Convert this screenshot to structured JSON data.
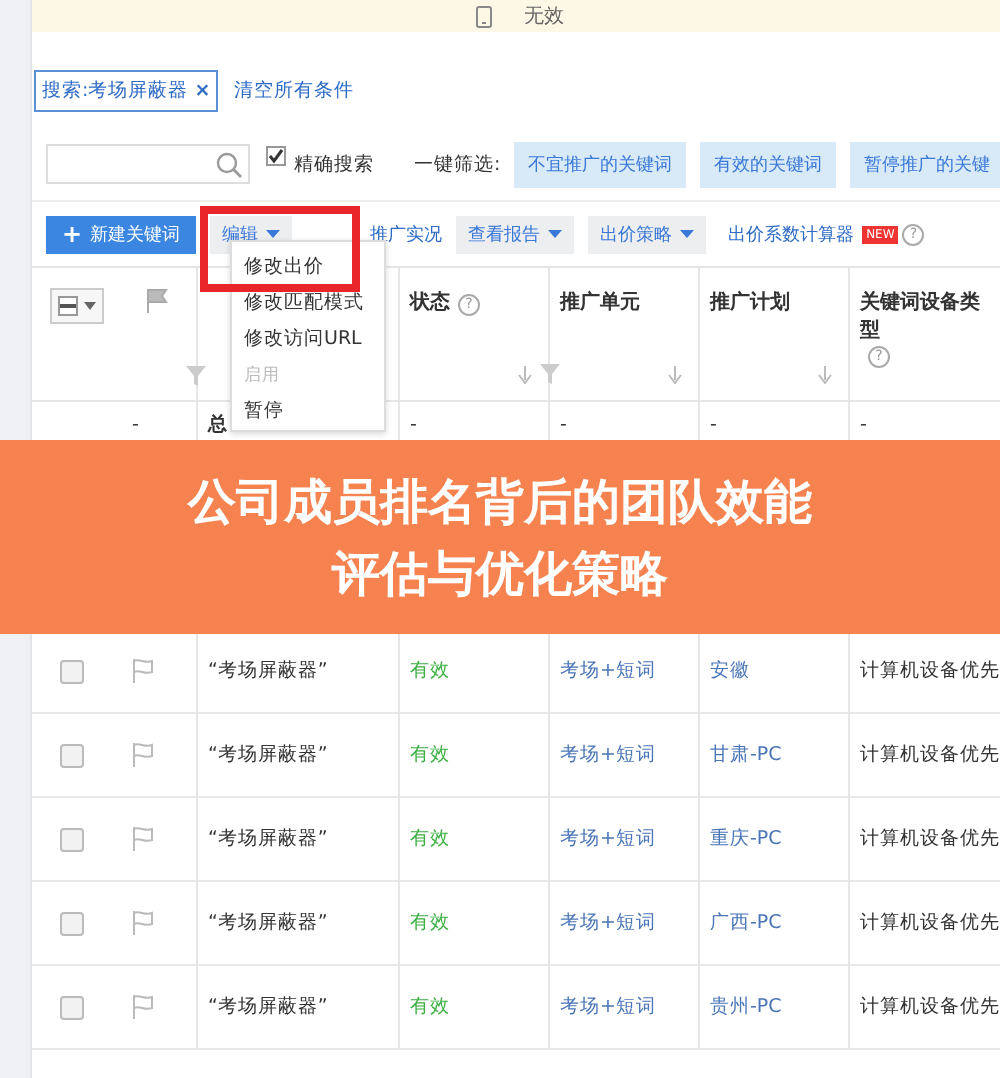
{
  "notice": {
    "text": "无效"
  },
  "filter_tags": [
    {
      "label": "搜索:考场屏蔽器",
      "remove": "×"
    }
  ],
  "clear_link": "清空所有条件",
  "search": {
    "exact_match": {
      "label": "精确搜索",
      "checked": true
    }
  },
  "quick_filter": {
    "label": "一键筛选:",
    "chips": [
      "不宜推广的关键词",
      "有效的关键词",
      "暂停推广的关键"
    ]
  },
  "toolbar": [
    {
      "kind": "primary",
      "label": "新建关键词",
      "icon": "+"
    },
    {
      "kind": "dropdown",
      "label": "编辑"
    },
    {
      "kind": "link",
      "label": "推广实况"
    },
    {
      "kind": "dropdown",
      "label": "查看报告"
    },
    {
      "kind": "dropdown",
      "label": "出价策略"
    },
    {
      "kind": "link",
      "label": "出价系数计算器",
      "badge": "NEW",
      "help": "?"
    }
  ],
  "edit_menu": {
    "items": [
      {
        "label": "修改出价",
        "disabled": false
      },
      {
        "label": "修改匹配模式",
        "disabled": false
      },
      {
        "label": "修改访问URL",
        "disabled": false
      },
      {
        "label": "启用",
        "disabled": true
      },
      {
        "label": "暂停",
        "disabled": false
      }
    ]
  },
  "table": {
    "select_all": {
      "indeterminate": true
    },
    "columns": [
      {
        "kind": "select"
      },
      {
        "kind": "flag"
      },
      {
        "kind": "keyword"
      },
      {
        "kind": "text",
        "label": "状态",
        "help": "?"
      },
      {
        "kind": "text",
        "label": "推广单元"
      },
      {
        "kind": "text",
        "label": "推广计划"
      },
      {
        "kind": "text",
        "label": "关键词设备类型",
        "help": "?"
      }
    ],
    "total_row": {
      "mark": "-",
      "label": "总",
      "cells": [
        "-",
        "-",
        "-",
        "-"
      ]
    },
    "rows": [
      {
        "selected": false,
        "keyword": "“考场屏蔽器”",
        "status": "有效",
        "unit": "考场+短词",
        "plan": "安徽",
        "device": "计算机设备优先"
      },
      {
        "selected": false,
        "keyword": "“考场屏蔽器”",
        "status": "有效",
        "unit": "考场+短词",
        "plan": "甘肃-PC",
        "device": "计算机设备优先"
      },
      {
        "selected": false,
        "keyword": "“考场屏蔽器”",
        "status": "有效",
        "unit": "考场+短词",
        "plan": "重庆-PC",
        "device": "计算机设备优先"
      },
      {
        "selected": false,
        "keyword": "“考场屏蔽器”",
        "status": "有效",
        "unit": "考场+短词",
        "plan": "广西-PC",
        "device": "计算机设备优先"
      },
      {
        "selected": false,
        "keyword": "“考场屏蔽器”",
        "status": "有效",
        "unit": "考场+短词",
        "plan": "贵州-PC",
        "device": "计算机设备优先"
      }
    ]
  },
  "banner": {
    "lines": [
      "公司成员排名背后的团队效能",
      "评估与优化策略"
    ]
  }
}
